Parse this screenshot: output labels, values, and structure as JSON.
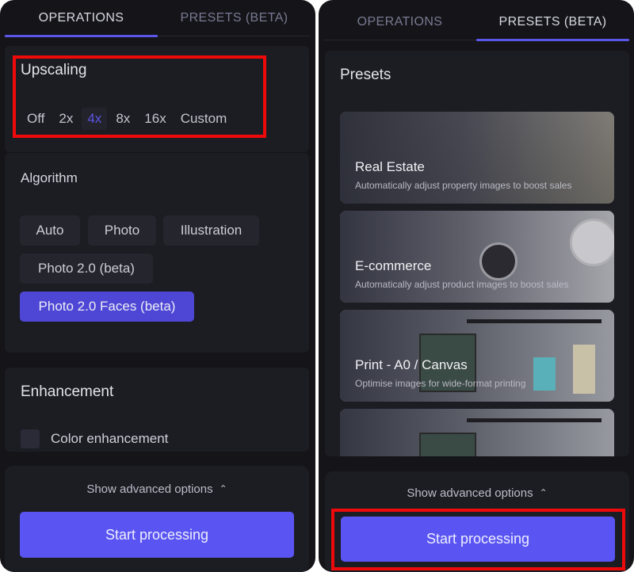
{
  "left_panel": {
    "tabs": [
      {
        "label": "OPERATIONS",
        "active": true
      },
      {
        "label": "PRESETS (BETA)",
        "active": false
      }
    ],
    "upscaling": {
      "title": "Upscaling",
      "options": [
        "Off",
        "2x",
        "4x",
        "8x",
        "16x",
        "Custom"
      ],
      "selected": "4x"
    },
    "algorithm": {
      "title": "Algorithm",
      "options": [
        "Auto",
        "Photo",
        "Illustration",
        "Photo 2.0 (beta)",
        "Photo 2.0 Faces (beta)"
      ],
      "selected": "Photo 2.0 Faces (beta)"
    },
    "enhancement": {
      "title": "Enhancement",
      "color_enhancement_label": "Color enhancement",
      "color_enhancement_checked": false
    },
    "footer": {
      "advanced_label": "Show advanced options",
      "start_label": "Start processing"
    }
  },
  "right_panel": {
    "tabs": [
      {
        "label": "OPERATIONS",
        "active": false
      },
      {
        "label": "PRESETS (BETA)",
        "active": true
      }
    ],
    "presets_title": "Presets",
    "presets": [
      {
        "title": "Real Estate",
        "description": "Automatically adjust property images to boost sales",
        "image": "living-room-photo"
      },
      {
        "title": "E-commerce",
        "description": "Automatically adjust product images to boost sales",
        "image": "watches-photo"
      },
      {
        "title": "Print - A0 / Canvas",
        "description": "Optimise images for wide-format printing",
        "image": "framed-prints-photo"
      },
      {
        "title": "",
        "description": "",
        "image": "framed-prints-photo"
      }
    ],
    "footer": {
      "advanced_label": "Show advanced options",
      "start_label": "Start processing"
    }
  },
  "colors": {
    "accent": "#5a55f2",
    "selected_text": "#5d55e6",
    "annotation": "#ee0a0a",
    "background": "#141419"
  }
}
